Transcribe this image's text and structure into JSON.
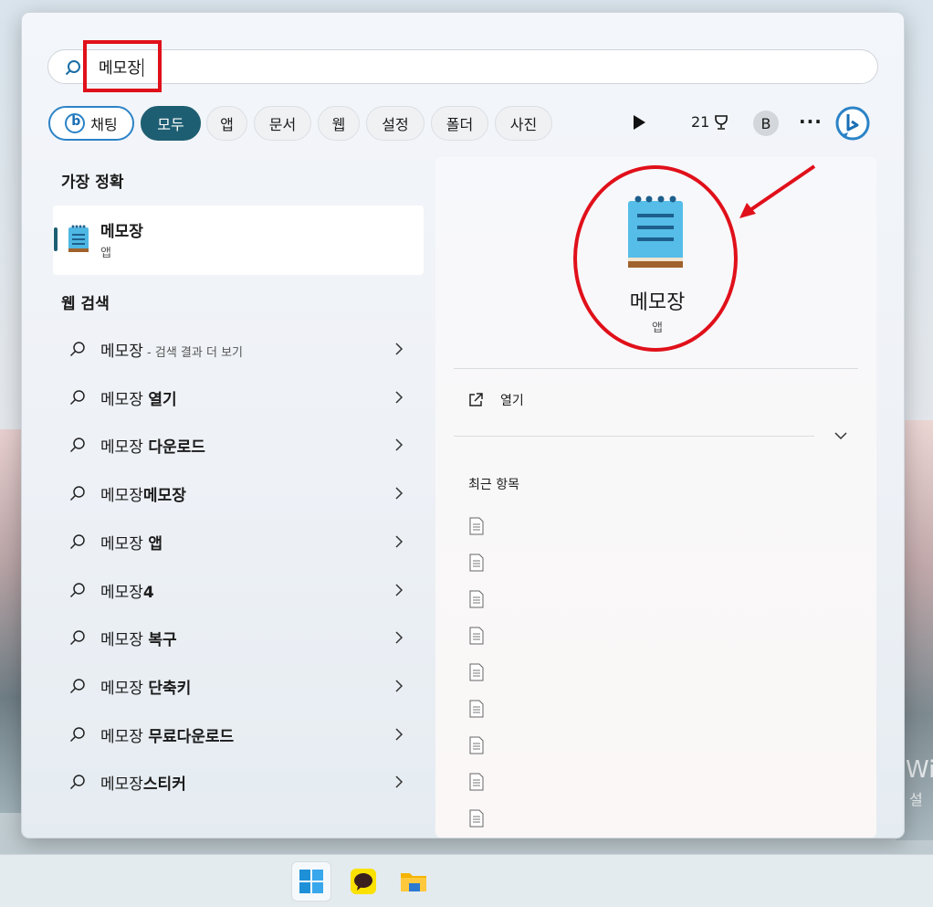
{
  "search": {
    "query": "메모장"
  },
  "filters": {
    "chat_label": "채팅",
    "chips": [
      "모두",
      "앱",
      "문서",
      "웹",
      "설정",
      "폴더",
      "사진"
    ],
    "points": "21",
    "avatar_letter": "B",
    "more_label": "···"
  },
  "best_match": {
    "section_title": "가장 정확",
    "name": "메모장",
    "type": "앱"
  },
  "web_search": {
    "section_title": "웹 검색",
    "items": [
      {
        "prefix": "메모장",
        "bold": "",
        "sub": " - 검색 결과 더 보기"
      },
      {
        "prefix": "메모장 ",
        "bold": "열기",
        "sub": ""
      },
      {
        "prefix": "메모장 ",
        "bold": "다운로드",
        "sub": ""
      },
      {
        "prefix": "메모장",
        "bold": "메모장",
        "sub": ""
      },
      {
        "prefix": "메모장 ",
        "bold": "앱",
        "sub": ""
      },
      {
        "prefix": "메모장",
        "bold": "4",
        "sub": ""
      },
      {
        "prefix": "메모장 ",
        "bold": "복구",
        "sub": ""
      },
      {
        "prefix": "메모장 ",
        "bold": "단축키",
        "sub": ""
      },
      {
        "prefix": "메모장 ",
        "bold": "무료다운로드",
        "sub": ""
      },
      {
        "prefix": "메모장",
        "bold": "스티커",
        "sub": ""
      }
    ]
  },
  "detail": {
    "app_name": "메모장",
    "app_type": "앱",
    "open_label": "열기",
    "recent_title": "최근 항목",
    "recent_count": 9
  },
  "desktop": {
    "watermark": "Wi",
    "watermark_sub": "설"
  },
  "colors": {
    "accent": "#1e5e72",
    "annotation_red": "#e0101a",
    "bing_blue": "#2b83c7"
  }
}
